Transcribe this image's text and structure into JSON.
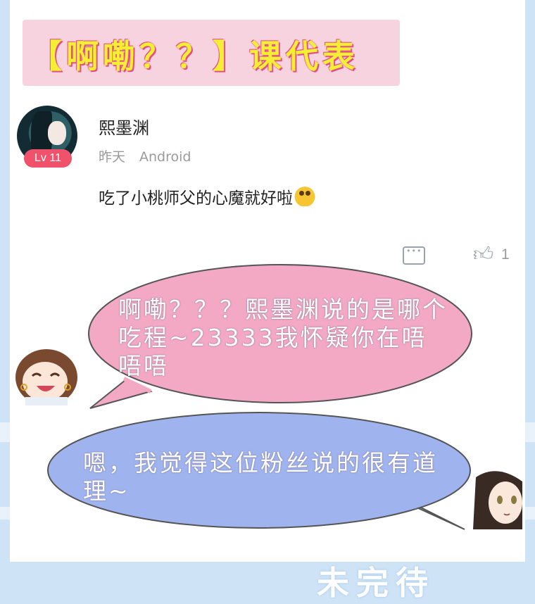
{
  "title_banner": {
    "text": "【啊嘞？？】课代表"
  },
  "comment": {
    "level_badge": "Lv 11",
    "username": "熙墨渊",
    "time": "昨天",
    "device": "Android",
    "text": "吃了小桃师父的心魔就好啦",
    "emoji_icon": "smiley-emoji-icon",
    "reply_icon": "comment-reply-icon",
    "like_icon": "thumbs-up-icon",
    "like_count": "1"
  },
  "bubbles": {
    "pink": {
      "text": "啊嘞？？？熙墨渊说的是哪个吃程~23333我怀疑你在唔唔唔",
      "color": "#f3a9c4"
    },
    "blue": {
      "text": "嗯，我觉得这位粉丝说的很有道理~",
      "color": "#9fb4ee"
    }
  },
  "footer": {
    "text": "未完待"
  },
  "colors": {
    "accent_pink": "#f0516b",
    "background_blue": "#cfe3f6"
  }
}
